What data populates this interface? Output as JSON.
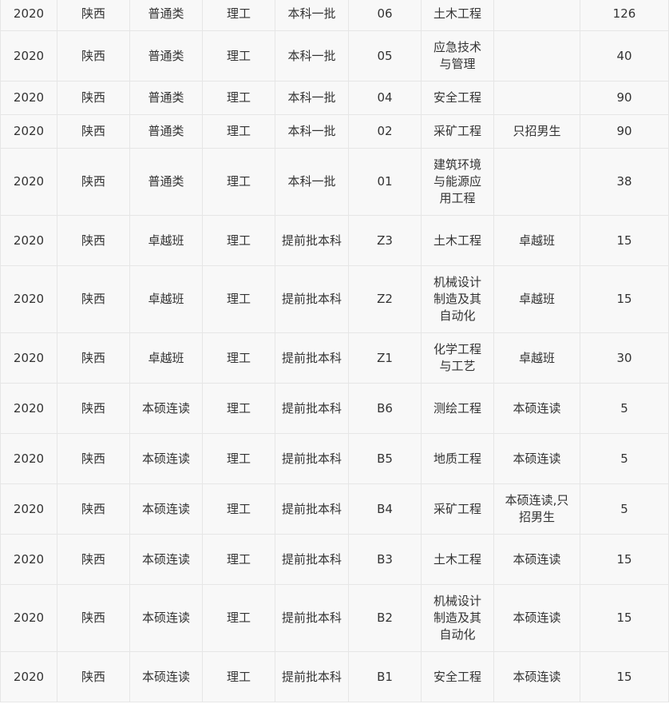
{
  "table": {
    "rows": [
      [
        "2020",
        "陕西",
        "普通类",
        "理工",
        "本科一批",
        "06",
        "土木工程",
        "",
        "126"
      ],
      [
        "2020",
        "陕西",
        "普通类",
        "理工",
        "本科一批",
        "05",
        "应急技术与管理",
        "",
        "40"
      ],
      [
        "2020",
        "陕西",
        "普通类",
        "理工",
        "本科一批",
        "04",
        "安全工程",
        "",
        "90"
      ],
      [
        "2020",
        "陕西",
        "普通类",
        "理工",
        "本科一批",
        "02",
        "采矿工程",
        "只招男生",
        "90"
      ],
      [
        "2020",
        "陕西",
        "普通类",
        "理工",
        "本科一批",
        "01",
        "建筑环境与能源应用工程",
        "",
        "38"
      ],
      [
        "2020",
        "陕西",
        "卓越班",
        "理工",
        "提前批本科",
        "Z3",
        "土木工程",
        "卓越班",
        "15"
      ],
      [
        "2020",
        "陕西",
        "卓越班",
        "理工",
        "提前批本科",
        "Z2",
        "机械设计制造及其自动化",
        "卓越班",
        "15"
      ],
      [
        "2020",
        "陕西",
        "卓越班",
        "理工",
        "提前批本科",
        "Z1",
        "化学工程与工艺",
        "卓越班",
        "30"
      ],
      [
        "2020",
        "陕西",
        "本硕连读",
        "理工",
        "提前批本科",
        "B6",
        "测绘工程",
        "本硕连读",
        "5"
      ],
      [
        "2020",
        "陕西",
        "本硕连读",
        "理工",
        "提前批本科",
        "B5",
        "地质工程",
        "本硕连读",
        "5"
      ],
      [
        "2020",
        "陕西",
        "本硕连读",
        "理工",
        "提前批本科",
        "B4",
        "采矿工程",
        "本硕连读,只招男生",
        "5"
      ],
      [
        "2020",
        "陕西",
        "本硕连读",
        "理工",
        "提前批本科",
        "B3",
        "土木工程",
        "本硕连读",
        "15"
      ],
      [
        "2020",
        "陕西",
        "本硕连读",
        "理工",
        "提前批本科",
        "B2",
        "机械设计制造及其自动化",
        "本硕连读",
        "15"
      ],
      [
        "2020",
        "陕西",
        "本硕连读",
        "理工",
        "提前批本科",
        "B1",
        "安全工程",
        "本硕连读",
        "15"
      ]
    ]
  }
}
